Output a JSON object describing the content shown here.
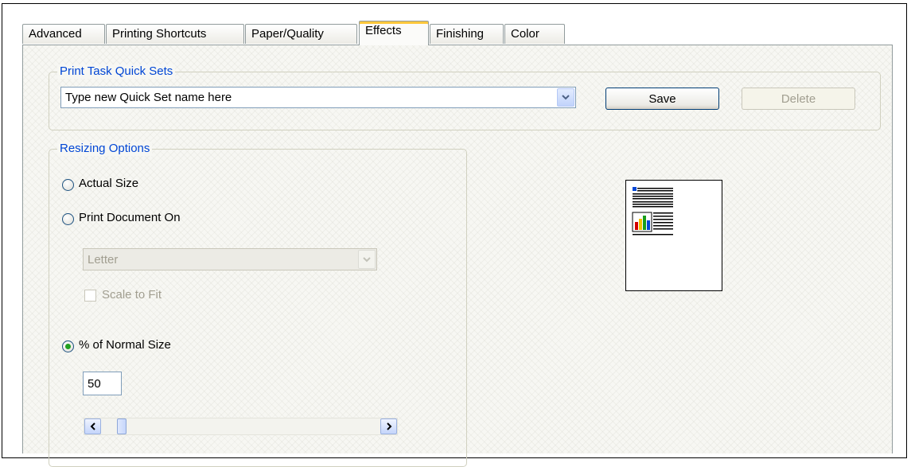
{
  "tabs": [
    {
      "label": "Advanced",
      "active": false
    },
    {
      "label": "Printing Shortcuts",
      "active": false
    },
    {
      "label": "Paper/Quality",
      "active": false
    },
    {
      "label": "Effects",
      "active": true
    },
    {
      "label": "Finishing",
      "active": false
    },
    {
      "label": "Color",
      "active": false
    }
  ],
  "quick_sets": {
    "legend": "Print Task Quick Sets",
    "value": "Type new Quick Set name here",
    "save_label": "Save",
    "delete_label": "Delete"
  },
  "resizing": {
    "legend": "Resizing Options",
    "actual_size_label": "Actual Size",
    "print_on_label": "Print Document On",
    "paper_value": "Letter",
    "scale_label": "Scale to Fit",
    "percent_label": "% of Normal Size",
    "percent_value": "50",
    "selected_option": "percent",
    "slider_fraction": 0.03
  },
  "colors": {
    "accent": "#0046d5",
    "radio_selected": "#21a121",
    "active_tab_highlight": "#ffc83c"
  },
  "icons": [
    "dropdown-arrow-icon",
    "scroll-left-icon",
    "scroll-right-icon",
    "document-preview-icon"
  ]
}
